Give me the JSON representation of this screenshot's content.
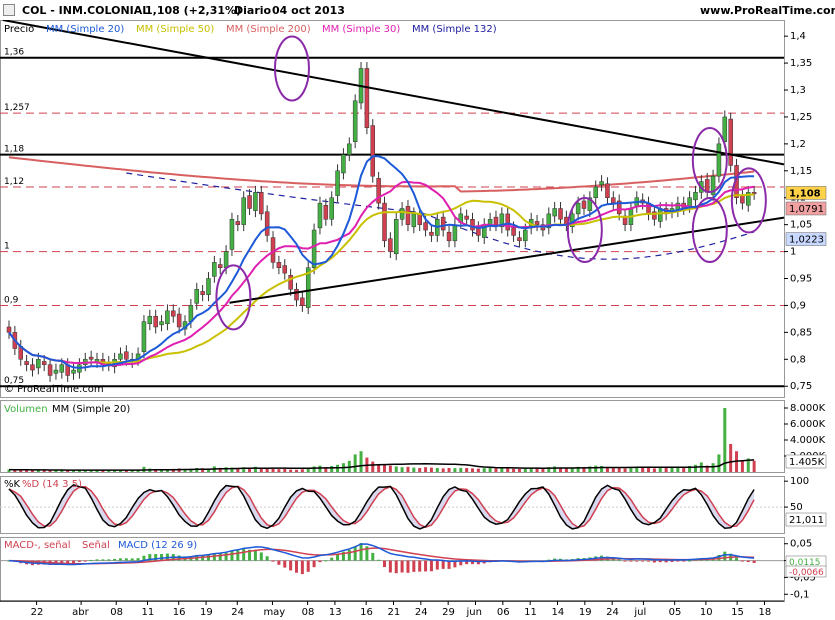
{
  "header": {
    "symbol": "COL - INM.COLONIAL",
    "price_change": "1,108 (+2,31%)",
    "period": "Diario",
    "date": "04 oct 2013",
    "site": "www.ProRealTime.com"
  },
  "copyright": "© ProRealTime.com",
  "colors": {
    "up": "#44b044",
    "down": "#d04050",
    "mm20": "#1e5ad8",
    "mm50": "#c8c000",
    "mm200": "#d86060",
    "mm30": "#e020b0",
    "mm132": "#2020a0",
    "ellipse": "#8a2aa8"
  },
  "chart_data": [
    {
      "type": "candlestick",
      "name": "price",
      "legend": [
        {
          "label": "Precio",
          "color": "#000000"
        },
        {
          "label": "MM (Simple 20)",
          "color": "#1e5ad8"
        },
        {
          "label": "MM (Simple 50)",
          "color": "#c8c000"
        },
        {
          "label": "MM (Simple 200)",
          "color": "#d86060"
        },
        {
          "label": "MM (Simple 30)",
          "color": "#e020b0"
        },
        {
          "label": "MM (Simple 132)",
          "color": "#2020a0"
        }
      ],
      "ylim": [
        0.73,
        1.43
      ],
      "yticks": [
        "1,4",
        "1,35",
        "1,3",
        "1,25",
        "1,2",
        "1,15",
        "1,1",
        "1,05",
        "1",
        "0,95",
        "0,9",
        "0,85",
        "0,8",
        "0,75"
      ],
      "ytick_values": [
        1.4,
        1.35,
        1.3,
        1.25,
        1.2,
        1.15,
        1.1,
        1.05,
        1.0,
        0.95,
        0.9,
        0.85,
        0.8,
        0.75
      ],
      "solid_levels": [
        {
          "value": 1.36,
          "label": "1,36"
        },
        {
          "value": 1.18,
          "label": "1,18"
        },
        {
          "value": 0.75,
          "label": "0,75"
        }
      ],
      "dashed_levels": [
        {
          "value": 1.257,
          "label": "1,257"
        },
        {
          "value": 1.12,
          "label": "1,12"
        },
        {
          "value": 1.0,
          "label": "1"
        },
        {
          "value": 0.9,
          "label": "0,9"
        }
      ],
      "value_badges": [
        {
          "label": "1,108",
          "value": 1.108,
          "color": "#ffd24a"
        },
        {
          "label": "1,0791",
          "value": 1.0791,
          "color": "#f0a0a0"
        },
        {
          "label": "1,0223",
          "value": 1.0223,
          "color": "#c8d8ff"
        }
      ],
      "trendlines": [
        {
          "from": [
            0.0,
            1.43
          ],
          "to": [
            1.0,
            1.162
          ]
        },
        {
          "from": [
            0.29,
            0.905
          ],
          "to": [
            1.0,
            1.063
          ]
        }
      ],
      "ellipses": [
        {
          "x": 0.37,
          "y": 1.34
        },
        {
          "x": 0.295,
          "y": 0.915
        },
        {
          "x": 0.745,
          "y": 1.04
        },
        {
          "x": 0.905,
          "y": 1.17
        },
        {
          "x": 0.905,
          "y": 1.04
        },
        {
          "x": 0.955,
          "y": 1.095
        }
      ],
      "closes": [
        0.85,
        0.82,
        0.8,
        0.79,
        0.78,
        0.8,
        0.79,
        0.77,
        0.78,
        0.79,
        0.77,
        0.78,
        0.79,
        0.8,
        0.8,
        0.8,
        0.79,
        0.79,
        0.8,
        0.81,
        0.8,
        0.8,
        0.81,
        0.87,
        0.88,
        0.86,
        0.87,
        0.89,
        0.88,
        0.86,
        0.87,
        0.9,
        0.93,
        0.92,
        0.95,
        0.98,
        0.97,
        1.0,
        1.06,
        1.05,
        1.1,
        1.08,
        1.11,
        1.07,
        1.03,
        0.98,
        0.97,
        0.96,
        0.93,
        0.91,
        0.9,
        0.97,
        1.04,
        1.09,
        1.06,
        1.1,
        1.15,
        1.18,
        1.2,
        1.28,
        1.34,
        1.23,
        1.14,
        1.09,
        1.02,
        1.0,
        1.06,
        1.08,
        1.05,
        1.07,
        1.05,
        1.04,
        1.03,
        1.06,
        1.04,
        1.02,
        1.05,
        1.07,
        1.06,
        1.04,
        1.03,
        1.05,
        1.06,
        1.05,
        1.07,
        1.04,
        1.03,
        1.02,
        1.04,
        1.06,
        1.05,
        1.04,
        1.07,
        1.08,
        1.06,
        1.05,
        1.07,
        1.09,
        1.08,
        1.1,
        1.12,
        1.13,
        1.1,
        1.09,
        1.07,
        1.05,
        1.08,
        1.1,
        1.09,
        1.07,
        1.06,
        1.08,
        1.07,
        1.08,
        1.09,
        1.08,
        1.1,
        1.11,
        1.13,
        1.11,
        1.14,
        1.2,
        1.25,
        1.16,
        1.1,
        1.09,
        1.11,
        1.108
      ]
    },
    {
      "type": "bar",
      "name": "volume",
      "legend": [
        {
          "label": "Volumen",
          "color": "#44b044"
        },
        {
          "label": "MM (Simple 20)",
          "color": "#000000"
        }
      ],
      "ylim": [
        0,
        9000
      ],
      "yticks": [
        "8.000K",
        "6.000K",
        "4.000K",
        "2.000K"
      ],
      "ytick_values": [
        8000,
        6000,
        4000,
        2000
      ],
      "last_value": "1.405K",
      "values": [
        300,
        280,
        250,
        300,
        200,
        220,
        250,
        180,
        260,
        220,
        200,
        240,
        210,
        250,
        230,
        220,
        200,
        260,
        250,
        220,
        240,
        260,
        280,
        650,
        420,
        380,
        350,
        300,
        400,
        450,
        380,
        420,
        500,
        480,
        450,
        700,
        520,
        600,
        550,
        480,
        600,
        500,
        650,
        480,
        420,
        400,
        350,
        380,
        300,
        280,
        350,
        500,
        700,
        800,
        600,
        750,
        900,
        1100,
        1400,
        2200,
        2600,
        1800,
        1300,
        1000,
        900,
        800,
        700,
        600,
        650,
        550,
        500,
        600,
        550,
        500,
        450,
        500,
        480,
        520,
        500,
        450,
        420,
        480,
        500,
        450,
        600,
        450,
        400,
        380,
        420,
        500,
        550,
        480,
        600,
        700,
        550,
        500,
        550,
        650,
        600,
        700,
        800,
        750,
        600,
        550,
        500,
        450,
        600,
        650,
        550,
        500,
        450,
        600,
        550,
        600,
        650,
        600,
        750,
        900,
        1200,
        800,
        1100,
        2200,
        8000,
        3500,
        2600,
        1500,
        1700,
        1405
      ]
    },
    {
      "type": "line",
      "name": "stochastic",
      "legend": [
        {
          "label": "%K",
          "color": "#000000"
        },
        {
          "label": "%D (14 3 5)",
          "color": "#d04050"
        }
      ],
      "ylim": [
        0,
        110
      ],
      "yticks": [
        "100",
        "50"
      ],
      "ytick_values": [
        100,
        50
      ],
      "last_value": "21,011",
      "cycle": [
        85,
        70,
        50,
        30,
        18,
        12,
        15,
        25,
        45,
        65,
        80,
        88,
        85
      ]
    },
    {
      "type": "line",
      "name": "macd",
      "legend": [
        {
          "label": "MACD-, señal",
          "color": "#d04050"
        },
        {
          "label": "Señal",
          "color": "#d04050"
        },
        {
          "label": "MACD (12 26 9)",
          "color": "#1e5ad8"
        }
      ],
      "ylim": [
        -0.12,
        0.07
      ],
      "yticks": [
        "0,05",
        "0",
        "-0,05",
        "-0,1"
      ],
      "ytick_values": [
        0.05,
        0,
        -0.05,
        -0.1
      ],
      "badge_values": [
        "0,0115",
        "-0,0066"
      ]
    }
  ],
  "xaxis": {
    "labels": [
      "22",
      "abr",
      "08",
      "11",
      "16",
      "19",
      "24",
      "may",
      "08",
      "13",
      "16",
      "21",
      "24",
      "29",
      "jun",
      "06",
      "11",
      "14",
      "19",
      "24",
      "jul",
      "05",
      "10",
      "15",
      "18"
    ],
    "fractions": [
      0.043,
      0.1,
      0.145,
      0.185,
      0.225,
      0.26,
      0.3,
      0.345,
      0.39,
      0.425,
      0.465,
      0.5,
      0.535,
      0.57,
      0.605,
      0.64,
      0.675,
      0.71,
      0.745,
      0.78,
      0.82,
      0.86,
      0.9,
      0.94,
      0.975
    ]
  }
}
